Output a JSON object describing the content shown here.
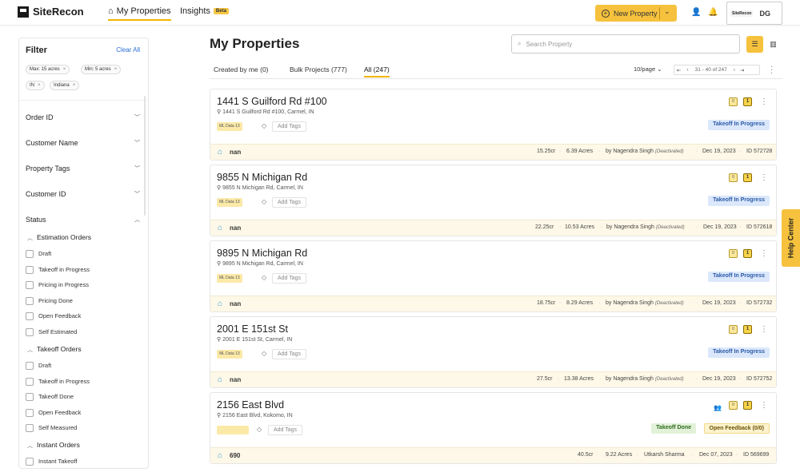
{
  "brand": {
    "name": "SiteRecon"
  },
  "nav": {
    "my_properties": "My Properties",
    "insights": "Insights",
    "beta": "Beta",
    "new_property": "New Property",
    "profile_logo": "SiteRecon",
    "initials": "DG"
  },
  "filter": {
    "title": "Filter",
    "clear_all": "Clear All",
    "chips": [
      "Max: 15 acres",
      "Min: 5 acres",
      "IN",
      "Indiana"
    ],
    "sections": [
      "Order ID",
      "Customer Name",
      "Property Tags",
      "Customer ID",
      "Status"
    ],
    "estimation_title": "Estimation Orders",
    "estimation": [
      "Draft",
      "Takeoff in Progress",
      "Pricing in Progress",
      "Pricing Done",
      "Open Feedback",
      "Self Estimated"
    ],
    "takeoff_title": "Takeoff Orders",
    "takeoff": [
      "Draft",
      "Takeoff in Progress",
      "Takeoff Done",
      "Open Feedback",
      "Self Measured"
    ],
    "instant_title": "Instant Orders",
    "instant": [
      "Instant Takeoff"
    ]
  },
  "main": {
    "title": "My Properties",
    "search_placeholder": "Search Property",
    "tabs": [
      "Created by me (0)",
      "Bulk Projects (777)",
      "All (247)"
    ],
    "per_page": "10/page",
    "range": "31 - 40 of 247"
  },
  "common": {
    "add_tags": "Add Tags",
    "ml_tag": "ML Data 13",
    "deactivated": "(Deactivated)",
    "sq_label": "0",
    "sq2_label": "1"
  },
  "properties": [
    {
      "name": "1441 S Guilford Rd #100",
      "address": "1441 S Guilford Rd #100, Carmel, IN",
      "status": "Takeoff In Progress",
      "pname": "nan",
      "cr": "15.25cr",
      "acres": "6.39 Acres",
      "by": "by Nagendra Singh",
      "date": "Dec 19, 2023",
      "id": "ID 572728"
    },
    {
      "name": "9855 N Michigan Rd",
      "address": "9855 N Michigan Rd, Carmel, IN",
      "status": "Takeoff In Progress",
      "pname": "nan",
      "cr": "22.25cr",
      "acres": "10.53 Acres",
      "by": "by Nagendra Singh",
      "date": "Dec 19, 2023",
      "id": "ID 572618"
    },
    {
      "name": "9895 N Michigan Rd",
      "address": "9895 N Michigan Rd, Carmel, IN",
      "status": "Takeoff In Progress",
      "pname": "nan",
      "cr": "18.75cr",
      "acres": "8.29 Acres",
      "by": "by Nagendra Singh",
      "date": "Dec 19, 2023",
      "id": "ID 572732"
    },
    {
      "name": "2001 E 151st St",
      "address": "2001 E 151st St, Carmel, IN",
      "status": "Takeoff In Progress",
      "pname": "nan",
      "cr": "27.5cr",
      "acres": "13.38 Acres",
      "by": "by Nagendra Singh",
      "date": "Dec 19, 2023",
      "id": "ID 572752"
    },
    {
      "name": "2156 East Blvd",
      "address": "2156 East Blvd, Kokomo, IN",
      "status": "Takeoff Done",
      "status2": "Open Feedback (0/0)",
      "pname": "690",
      "cr": "40.5cr",
      "acres": "9.22 Acres",
      "by": "Utkarsh Sharma",
      "date": "Dec 07, 2023",
      "id": "ID 569699"
    }
  ],
  "help": "Help Center",
  "colors": {
    "accent": "#f6c23d",
    "link": "#2b6fd6",
    "status_blue": "#dbe8fb",
    "footer": "#fdf8e7"
  }
}
